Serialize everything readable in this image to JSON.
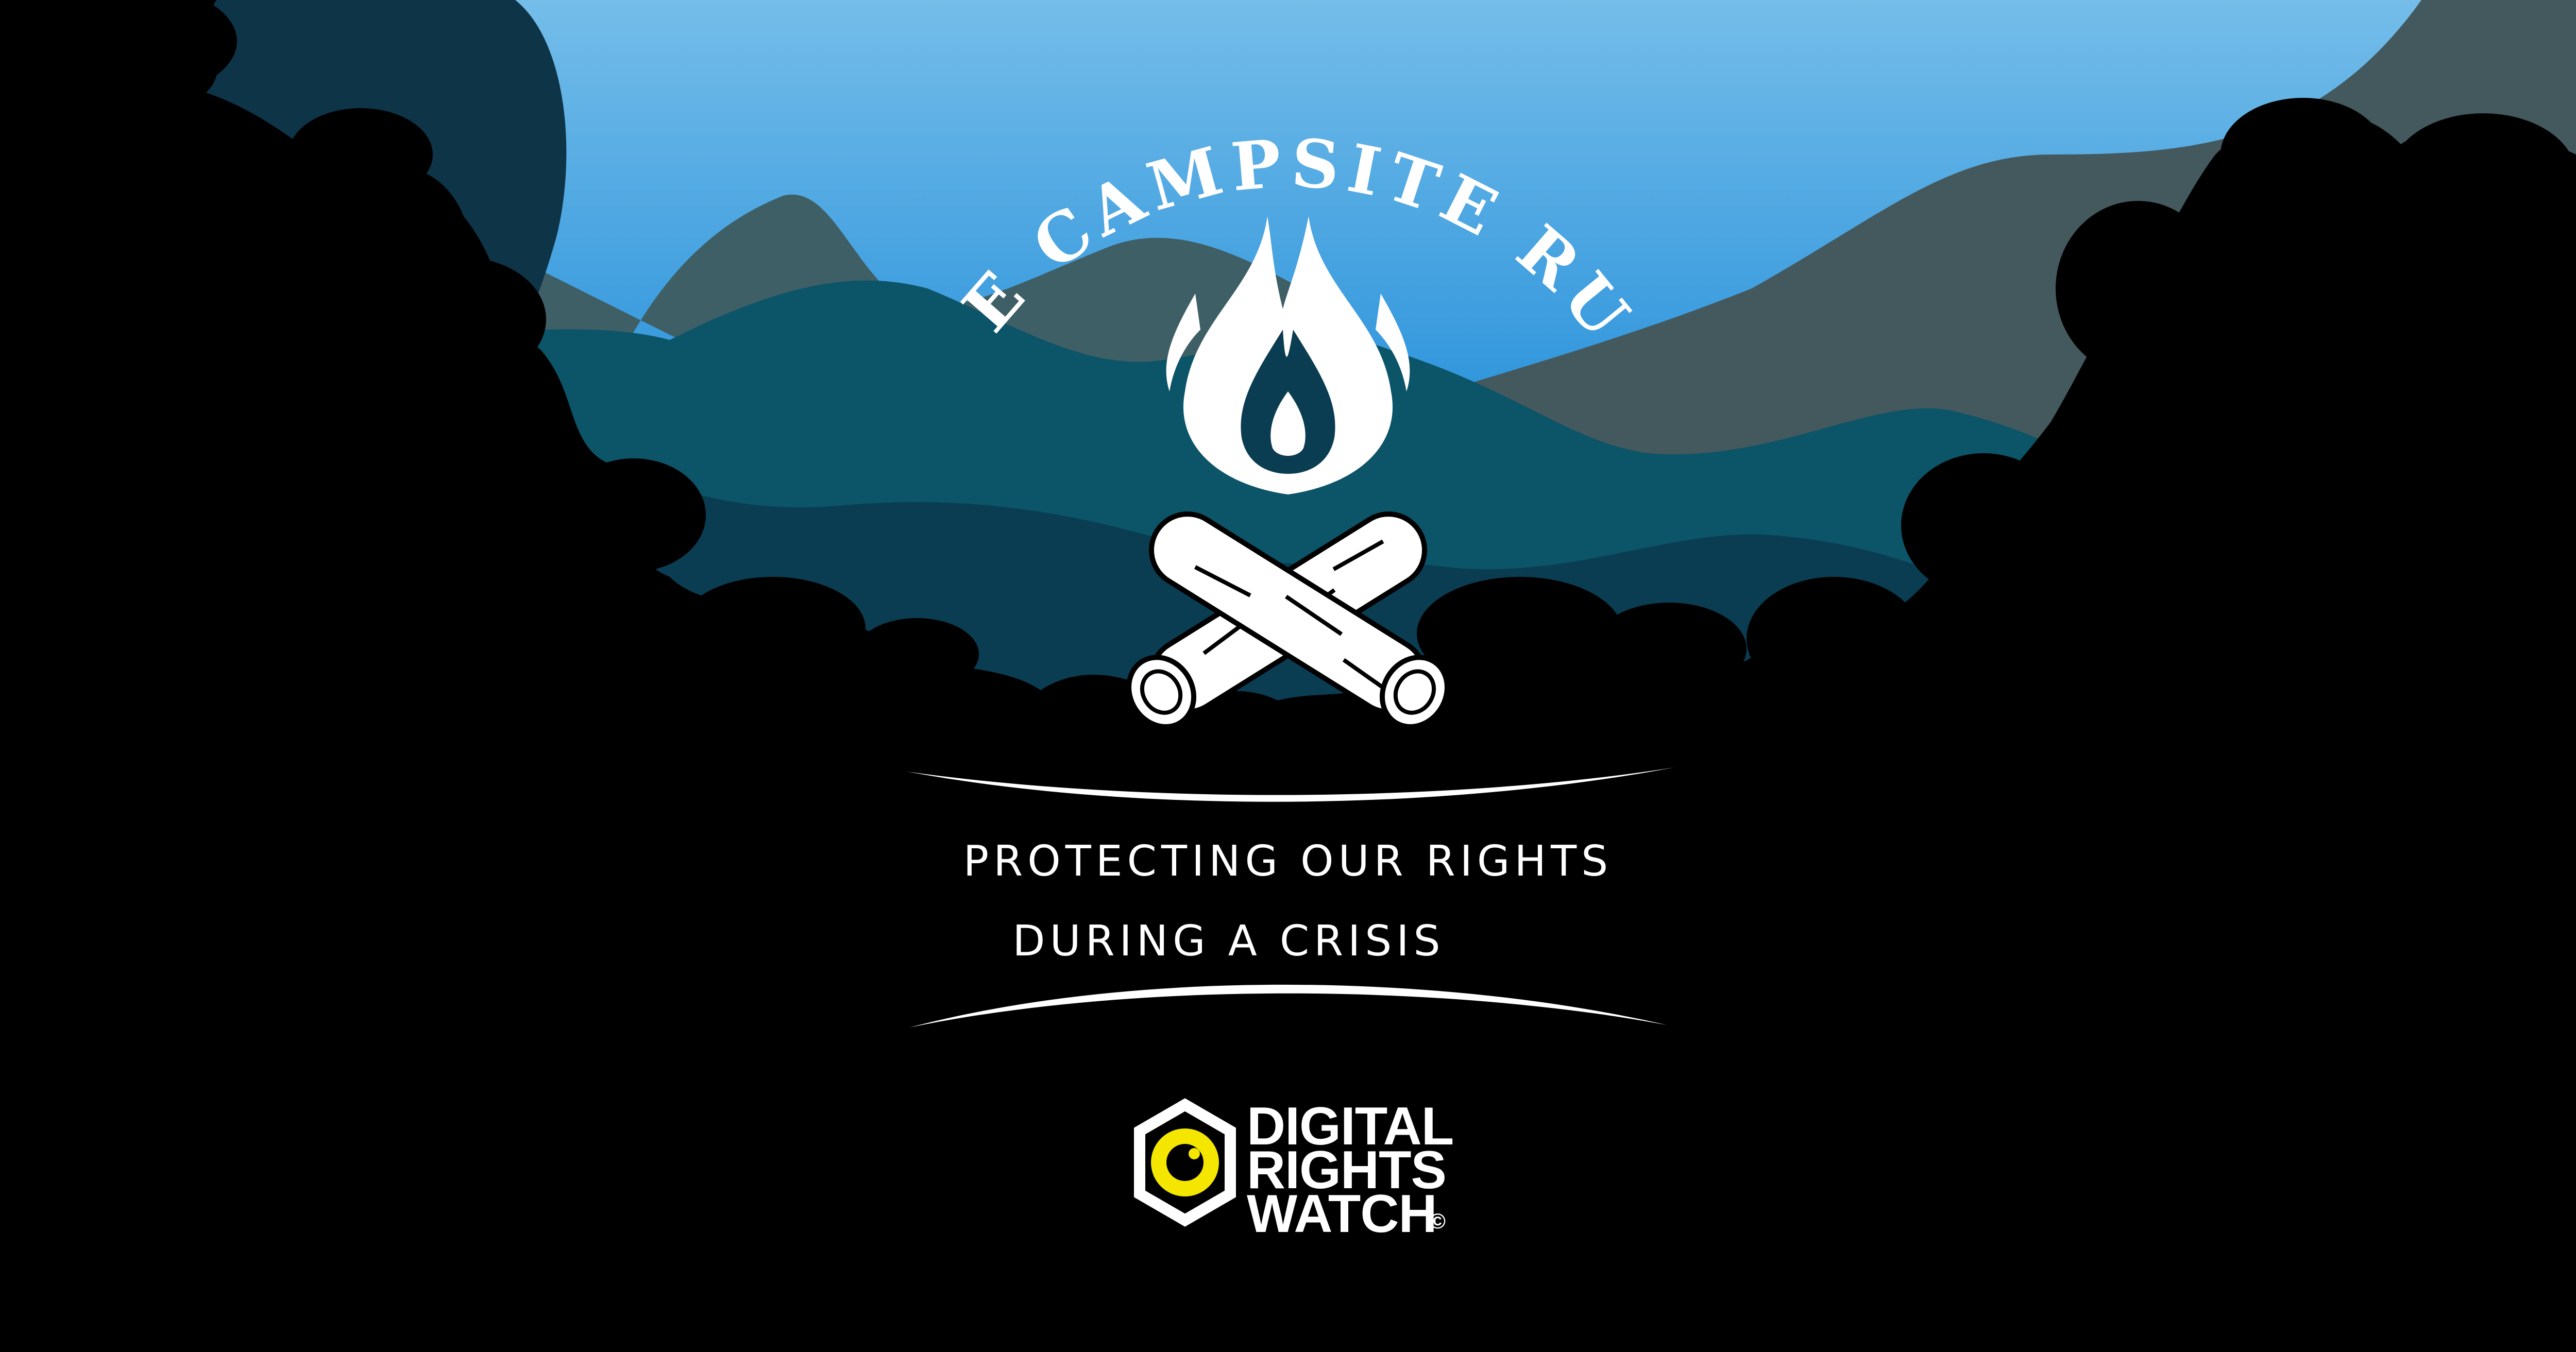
{
  "hero": {
    "title": "THE CAMPSITE RULE",
    "tagline_line1": "PROTECTING OUR RIGHTS",
    "tagline_line2": "DURING A CRISIS"
  },
  "brand": {
    "name_line1": "DIGITAL",
    "name_line2": "RIGHTS",
    "name_line3": "WATCH",
    "copyright_mark": "©",
    "logo_icon": "eye-hexagon-icon",
    "accent_color": "#f5e600"
  },
  "colors": {
    "sky_top": "#6db9e8",
    "sky_bottom": "#1f86d6",
    "mountain_grey": "#3f5f66",
    "mountain_teal": "#0c5468",
    "mountain_dark": "#0a3d52",
    "forest": "#000000",
    "text": "#ffffff"
  }
}
